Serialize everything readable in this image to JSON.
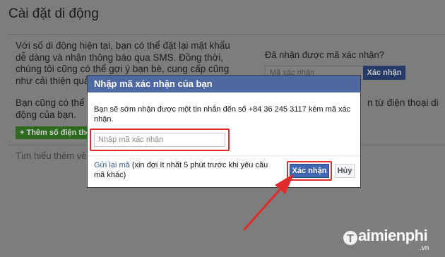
{
  "background": {
    "title": "Cài đặt di động",
    "paragraph": "Với số di động hiện tại, bạn có thể đặt lại mật khẩu dễ dàng và nhận thông báo qua SMS. Đồng thời, chúng tôi cũng có thể gợi ý bạn bè, cung cấp cũng như cải thiện quảng cáo cho bạ nhìn thấy số của",
    "paragraph2": "Bạn cũng có thể đ động của bạn.",
    "add_button": "+ Thêm số điện tho",
    "learn_more": "Tìm hiểu thêm về",
    "right_question": "Đã nhận được mã xác nhận?",
    "right_input_placeholder": "Mã xác nhận",
    "right_button": "Xác nhận",
    "right_text": "n từ điện thoại di"
  },
  "dialog": {
    "title": "Nhập mã xác nhận của bạn",
    "message": "Bạn sẽ sớm nhận được một tin nhắn đến số +84 36 245 3117 kèm mã xác nhận.",
    "input_placeholder": "Nhập mã xác nhận",
    "resend_link": "Gửi lại mã",
    "resend_note": " (xin đợi ít nhất 5 phút trước khi yêu cầu mã khác)",
    "confirm_button": "Xác nhận",
    "cancel_button": "Hủy"
  },
  "watermark": {
    "brand": "aimienphi",
    "suffix": ".vn"
  },
  "colors": {
    "dialog_header": "#4e69a2",
    "primary_button": "#4267b2",
    "highlight": "#e02b2b",
    "overlay": "#7d7d7d"
  }
}
